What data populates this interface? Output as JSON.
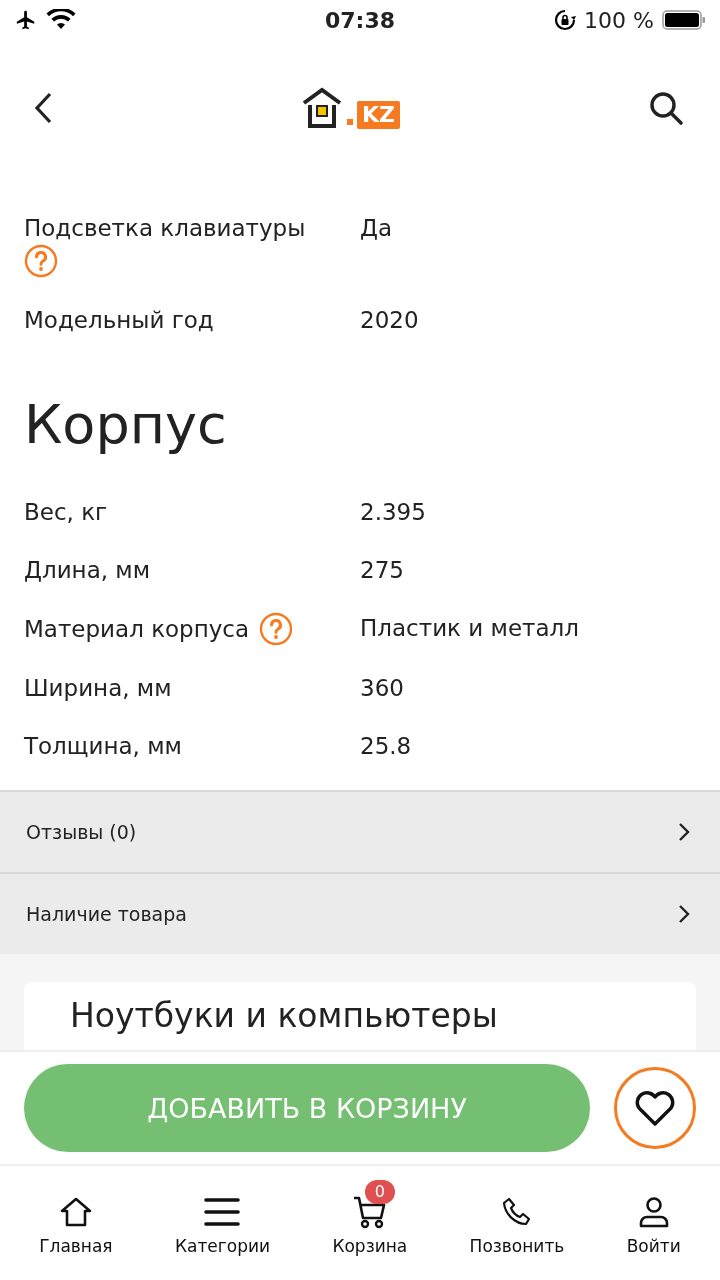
{
  "status_bar": {
    "time": "07:38",
    "battery": "100 %"
  },
  "header": {
    "logo_text": "KZ"
  },
  "specs_top": [
    {
      "label": "Подсветка клавиатуры",
      "value": "Да",
      "help": true
    },
    {
      "label": "Модельный год",
      "value": "2020",
      "help": false
    }
  ],
  "section": {
    "title": "Корпус",
    "rows": [
      {
        "label": "Вес, кг",
        "value": "2.395",
        "help": false
      },
      {
        "label": "Длина, мм",
        "value": "275",
        "help": false
      },
      {
        "label": "Материал корпуса",
        "value": "Пластик и металл",
        "help": true
      },
      {
        "label": "Ширина, мм",
        "value": "360",
        "help": false
      },
      {
        "label": "Толщина, мм",
        "value": "25.8",
        "help": false
      }
    ]
  },
  "links": [
    {
      "label": "Отзывы (0)"
    },
    {
      "label": "Наличие товара"
    }
  ],
  "card": {
    "title": "Ноутбуки и компьютеры"
  },
  "cta": {
    "label": "ДОБАВИТЬ В КОРЗИНУ"
  },
  "tab_bar": [
    {
      "kind": "home",
      "label": "Главная"
    },
    {
      "kind": "menu",
      "label": "Категории"
    },
    {
      "kind": "cart",
      "label": "Корзина",
      "badge": "0"
    },
    {
      "kind": "phone",
      "label": "Позвонить"
    },
    {
      "kind": "user",
      "label": "Войти"
    }
  ]
}
